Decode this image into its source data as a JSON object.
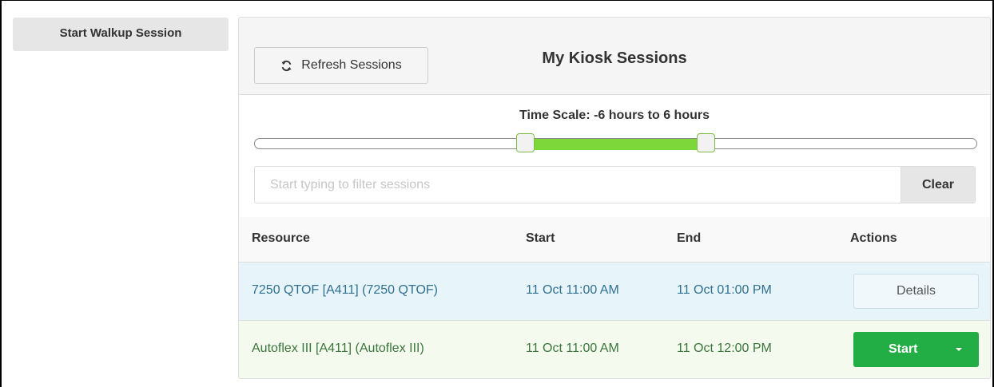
{
  "sidebar": {
    "walkup_label": "Start Walkup Session"
  },
  "panel": {
    "refresh_label": "Refresh Sessions",
    "refresh_icon": "refresh-icon",
    "title": "My Kiosk Sessions",
    "time_scale": {
      "label": "Time Scale: -6 hours to 6 hours",
      "min_hours": -6,
      "max_hours": 6,
      "range_start_fraction": 0.375,
      "range_end_fraction": 0.625
    },
    "filter": {
      "placeholder": "Start typing to filter sessions",
      "value": "",
      "clear_label": "Clear"
    },
    "table": {
      "columns": [
        "Resource",
        "Start",
        "End",
        "Actions"
      ],
      "rows": [
        {
          "resource": "7250 QTOF [A411] (7250 QTOF)",
          "start": "11 Oct 11:00 AM",
          "end": "11 Oct 01:00 PM",
          "action": "Details",
          "status": "info"
        },
        {
          "resource": "Autoflex III [A411] (Autoflex III)",
          "start": "11 Oct 11:00 AM",
          "end": "11 Oct 12:00 PM",
          "action": "Start",
          "status": "success"
        }
      ]
    }
  },
  "colors": {
    "range_fill": "#7dd63a",
    "start_button": "#22ad45",
    "info_row": "#e7f5fb",
    "success_row": "#f4fbee"
  }
}
